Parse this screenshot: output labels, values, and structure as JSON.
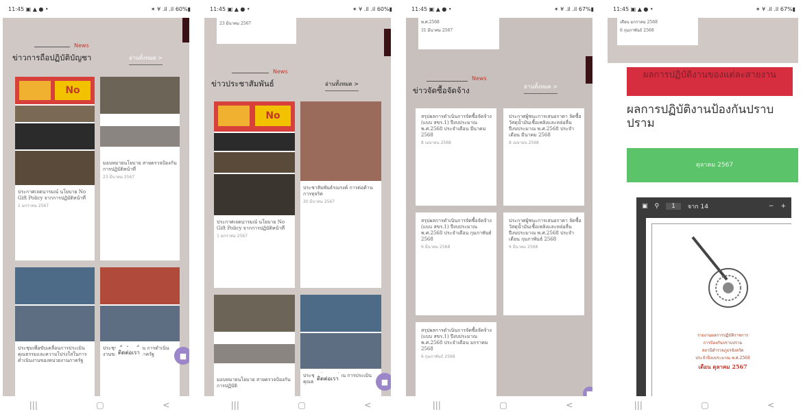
{
  "status": [
    {
      "time": "11:45",
      "icons": "▣ ▲ ● •",
      "right": "✶ ¥ .il .il 60%▮"
    },
    {
      "time": "11:45",
      "icons": "▣ ▲ ● •",
      "right": "✶ ¥ .il .il 60%▮"
    },
    {
      "time": "11:45",
      "icons": "▣ ▲ ● •",
      "right": "✶ ¥ .il .il 67%▮"
    },
    {
      "time": "11:45",
      "icons": "▣ ▲ ● •",
      "right": "✶ ¥ .il .il 67%▮"
    }
  ],
  "nav": {
    "recent": "|||",
    "home": "▢",
    "back": "<"
  },
  "p1": {
    "tag": "News",
    "title": "ข่าวการถือปฏิบัติบัญชา",
    "more": "อ่านทั้งหมด >",
    "c1": {
      "text": "ประกาศเจตนารมณ์ นโยบาย No Gift Policy จากการปฏิบัติหน้าที่",
      "date": "1 มกราคม 2567",
      "badge": "No"
    },
    "c2": {
      "text": "มอบหมายนโยบาย สายตรวจป้องกันการปฏิบัติหน้าที่",
      "date": "23 มีนาคม 2567"
    },
    "c3": {
      "text": "ประชุมเพื่อขับเคลื่อนการประเมินคุณธรรมและความโปร่งใสในการดำเนินงานของหน่วยงานภาครัฐ"
    },
    "c4": {
      "text": "ประชุมเพื่อขับเคลื่อน การดำเนินงานของหน่วยงานภาครัฐ"
    },
    "contact": "ติดต่อเรา"
  },
  "p2": {
    "topdate": "23 มีนาคม 2567",
    "tag": "News",
    "title": "ข่าวประชาสัมพันธ์",
    "more": "อ่านทั้งหมด >",
    "c1": {
      "text": "ประกาศเจตนารมณ์ นโยบาย No Gift Policy จากการปฏิบัติหน้าที่",
      "date": "1 มกราคม 2567",
      "badge": "No"
    },
    "c2": {
      "text": "ประชาสัมพันธ์รณรงค์ การต่อต้านการทุจริต",
      "date": "30 มีนาคม 2567"
    },
    "c3": {
      "text": "มอบหมายนโยบาย สายตรวจป้องกันการปฏิบัติ"
    },
    "c4": {
      "text": "ประชุมเพื่อขับเคลื่อน การประเมินคุณธรรม"
    },
    "contact": "ติดต่อเรา"
  },
  "p3": {
    "topline": "พ.ศ.2568",
    "topdate": "31 มีนาคม 2567",
    "tag": "News",
    "title": "ข่าวจัดซื้อจัดจ้าง",
    "more": "อ่านทั้งหมด >",
    "c1": {
      "text": "สรุปผลการดำเนินการจัดซื้อจัดจ้าง (แบบ สขร.1) ปีงบประมาณ พ.ศ.2568 ประจำเดือน มีนาคม 2568",
      "date": "8 เมษายน 2568"
    },
    "c2": {
      "text": "ประกาศผู้ชนะการเสนอราคา จัดซื้อวัสดุน้ำมันเชื้อเพลิงและหล่อลื่น ปีงบประมาณ พ.ศ.2568 ประจำเดือน มีนาคม 2568",
      "date": "8 เมษายน 2568"
    },
    "c3": {
      "text": "สรุปผลการดำเนินการจัดซื้อจัดจ้าง (แบบ สขร.1) ปีงบประมาณ พ.ศ.2568 ประจำเดือน กุมภาพันธ์ 2568",
      "date": "6 มีนาคม 2568"
    },
    "c4": {
      "text": "ประกาศผู้ชนะการเสนอราคา จัดซื้อวัสดุน้ำมันเชื้อเพลิงและหล่อลื่น ปีงบประมาณ พ.ศ.2568 ประจำเดือน กุมภาพันธ์ 2568",
      "date": "6 มีนาคม 2568"
    },
    "c5": {
      "text": "สรุปผลการดำเนินการจัดซื้อจัดจ้าง (แบบ สขร.1) ปีงบประมาณ พ.ศ.2568 ประจำเดือน มกราคม 2568",
      "date": "6 กุมภาพันธ์ 2568"
    }
  },
  "p4": {
    "topline": "เดือน มกราคม 2568",
    "topdate": "6 กุมภาพันธ์ 2568",
    "banner": "ผลการปฏิบัติงานของแต่ละสายงาน",
    "heading": "ผลการปฏิบัติงานป้องกันปราบปราม",
    "month": "ตุลาคม 2567",
    "pdf": {
      "page": "1",
      "of": "จาก 14",
      "minus": "−",
      "plus": "+",
      "lines": [
        "รายงานผลการปฏิบัติราชการ",
        "การป้องกันปราบปราม",
        "สถานีตำรวจภูธรจังหวัด",
        "ประจำปีงบประมาณ พ.ศ.2568"
      ],
      "month": "เดือน ตุลาคม 2567"
    }
  },
  "colors": {
    "bg": "#cfc8c5",
    "accent": "#c0392b",
    "dark": "#3a1215",
    "green": "#5bc46a",
    "red": "#d62d3f",
    "chat": "#9b86c9"
  }
}
